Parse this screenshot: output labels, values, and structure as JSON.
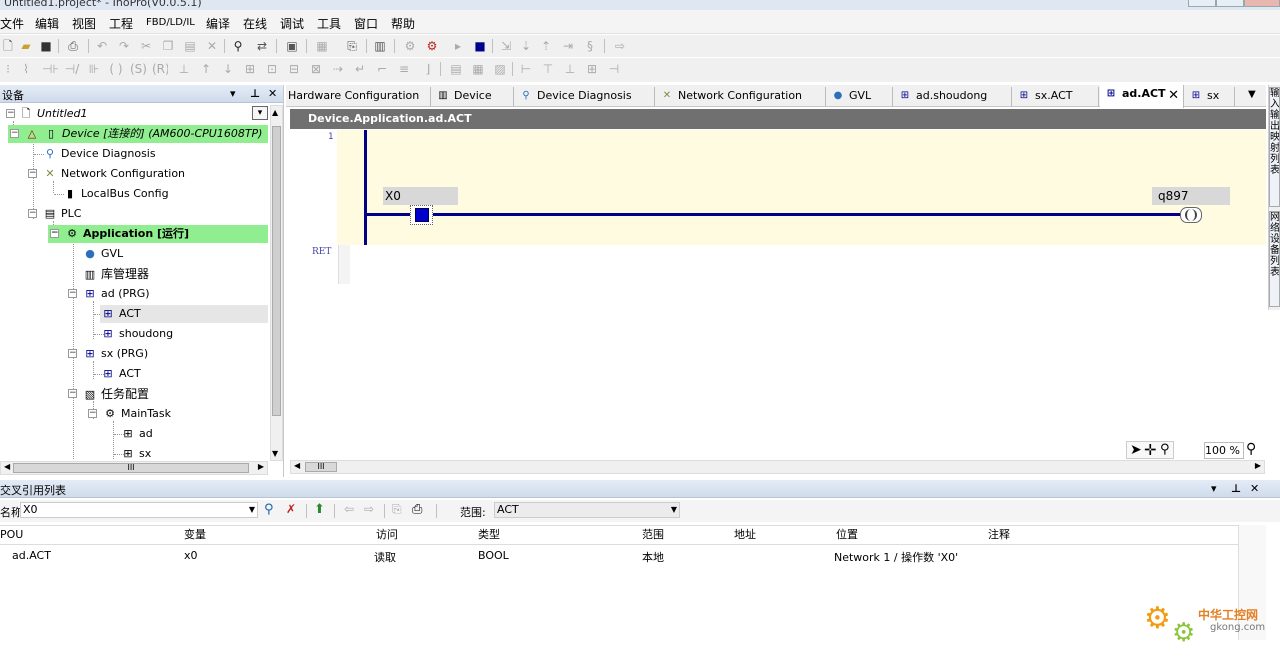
{
  "window": {
    "title": "Untitled1.project* - InoPro(V0.0.5.1)"
  },
  "menu": [
    "文件",
    "编辑",
    "视图",
    "工程",
    "FBD/LD/IL",
    "编译",
    "在线",
    "调试",
    "工具",
    "窗口",
    "帮助"
  ],
  "device_panel": {
    "title": "设备",
    "tree": [
      {
        "label": "Untitled1"
      },
      {
        "label": "Device [连接的] (AM600-CPU1608TP)"
      },
      {
        "label": "Device Diagnosis"
      },
      {
        "label": "Network Configuration"
      },
      {
        "label": "LocalBus Config"
      },
      {
        "label": "PLC"
      },
      {
        "label": "Application [运行]"
      },
      {
        "label": "GVL"
      },
      {
        "label": "库管理器"
      },
      {
        "label": "ad (PRG)"
      },
      {
        "label": "ACT"
      },
      {
        "label": "shoudong"
      },
      {
        "label": "sx (PRG)"
      },
      {
        "label": "ACT"
      },
      {
        "label": "任务配置"
      },
      {
        "label": "MainTask"
      },
      {
        "label": "ad"
      },
      {
        "label": "sx"
      }
    ],
    "hscroll_label": "III"
  },
  "editor": {
    "tabs": [
      "Hardware Configuration",
      "Device",
      "Device Diagnosis",
      "Network Configuration",
      "GVL",
      "ad.shoudong",
      "sx.ACT",
      "ad.ACT",
      "sx"
    ],
    "active_tab": "ad.ACT",
    "path": "Device.Application.ad.ACT",
    "network_number": "1",
    "contact_var": "X0",
    "coil_var": "q897",
    "ret_label": "RET",
    "zoom": "100 %",
    "hscroll_label": "III"
  },
  "right_strip": {
    "labels": [
      "输入输出映射列表",
      "网络设备列表"
    ]
  },
  "xref": {
    "title": "交叉引用列表",
    "name_label": "名称:",
    "name_value": "X0",
    "scope_label": "范围:",
    "scope_value": "ACT",
    "columns": [
      "POU",
      "变量",
      "访问",
      "类型",
      "范围",
      "地址",
      "位置",
      "注释"
    ],
    "rows": [
      {
        "pou": "ad.ACT",
        "var": "x0",
        "access": "读取",
        "type": "BOOL",
        "scope": "本地",
        "address": "",
        "location": "Network 1 / 操作数 'X0'",
        "comment": ""
      }
    ]
  },
  "watermark": {
    "cn": "中华工控网",
    "site": "gkong.com"
  },
  "colors": {
    "highlight": "#90ee90",
    "ladder_bg": "#fffbe0",
    "rung": "#00008b",
    "path_bar": "#707070"
  }
}
